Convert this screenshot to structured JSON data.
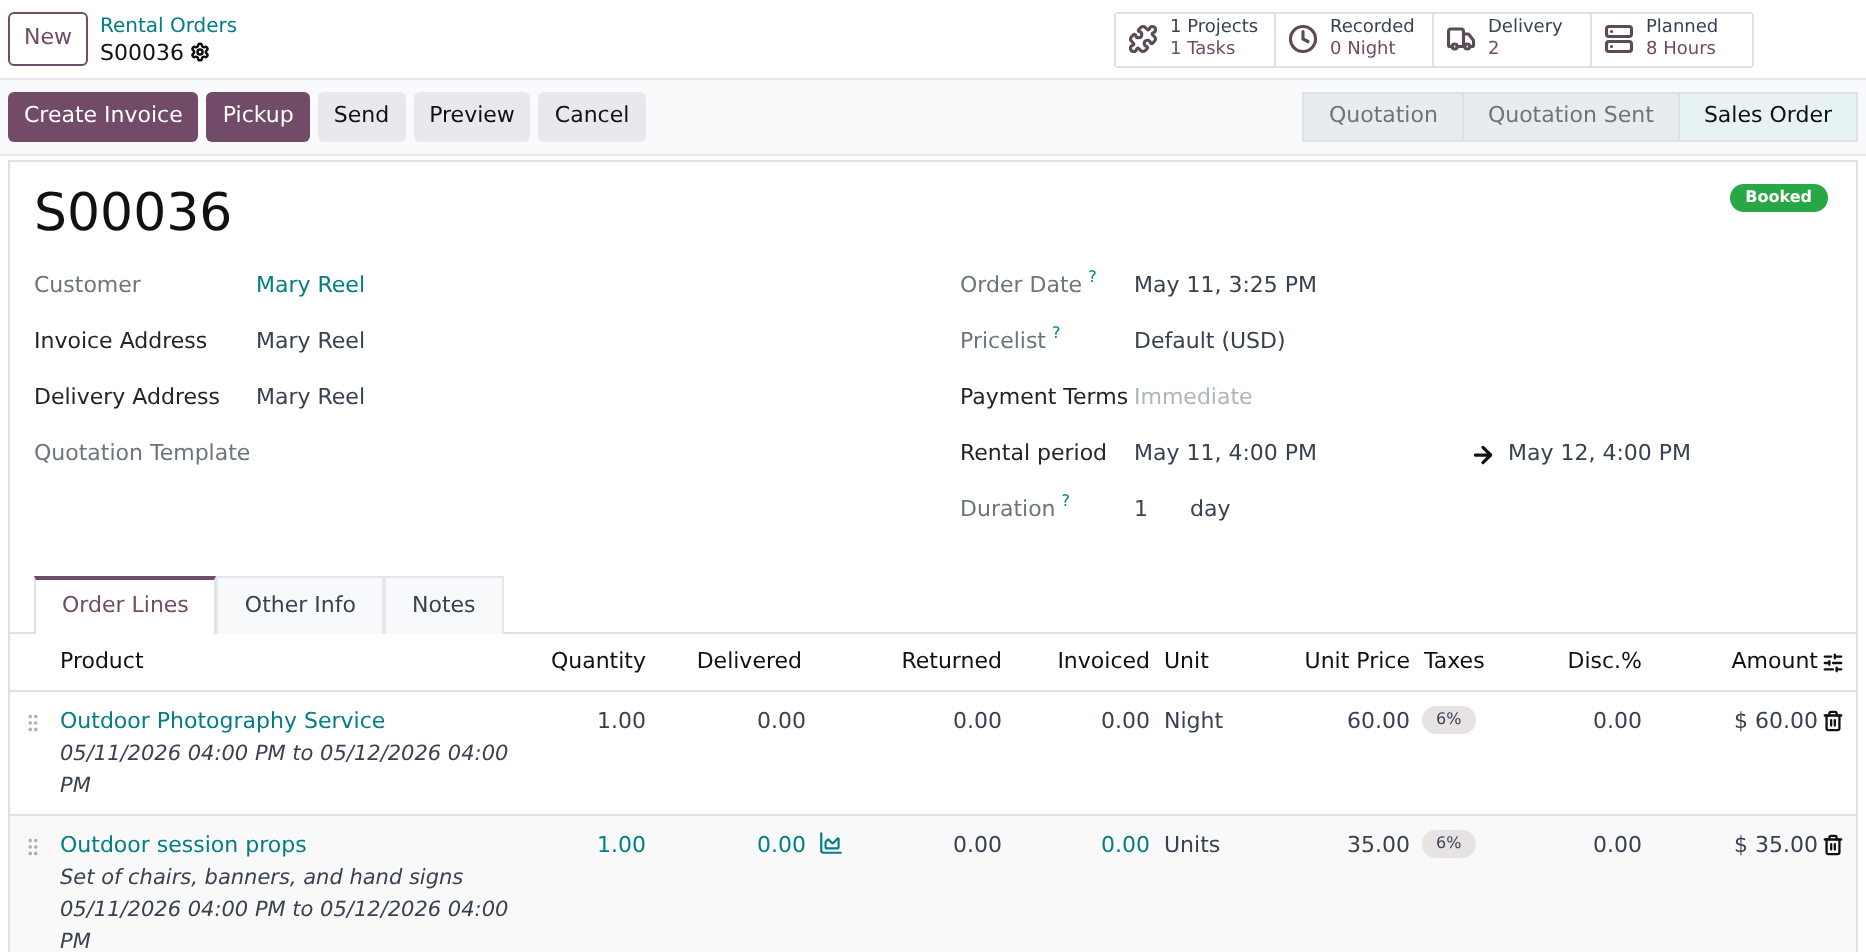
{
  "breadcrumb": {
    "new_button": "New",
    "parent": "Rental Orders",
    "current": "S00036"
  },
  "smart_buttons": [
    {
      "line1": "1 Projects",
      "line2": "1 Tasks"
    },
    {
      "line1": "Recorded",
      "line2": "0 Night"
    },
    {
      "line1": "Delivery",
      "line2": "2"
    },
    {
      "line1": "Planned",
      "line2": "8 Hours"
    }
  ],
  "actions": [
    {
      "label": "Create Invoice",
      "primary": true
    },
    {
      "label": "Pickup",
      "primary": true
    },
    {
      "label": "Send",
      "primary": false
    },
    {
      "label": "Preview",
      "primary": false
    },
    {
      "label": "Cancel",
      "primary": false
    }
  ],
  "stages": [
    {
      "label": "Quotation",
      "selected": false
    },
    {
      "label": "Quotation Sent",
      "selected": false
    },
    {
      "label": "Sales Order",
      "selected": true
    }
  ],
  "record": {
    "name": "S00036",
    "ribbon": "Booked"
  },
  "left_fields": [
    {
      "label": "Customer",
      "required": false,
      "value": "Mary Reel",
      "kind": "link"
    },
    {
      "label": "Invoice Address",
      "required": true,
      "value": "Mary Reel",
      "kind": "text"
    },
    {
      "label": "Delivery Address",
      "required": true,
      "value": "Mary Reel",
      "kind": "text"
    },
    {
      "label": "Quotation Template",
      "required": false,
      "kind": "empty"
    }
  ],
  "right_fields": [
    {
      "label": "Order Date",
      "help": "?",
      "required": false,
      "value": "May 11, 3:25 PM",
      "kind": "text"
    },
    {
      "label": "Pricelist",
      "help": "?",
      "required": false,
      "value": "Default (USD)",
      "kind": "text"
    },
    {
      "label": "Payment Terms",
      "required": true,
      "placeholder": "Immediate",
      "kind": "placeholder"
    },
    {
      "label": "Rental period",
      "required": true,
      "value": "May 11, 4:00 PM",
      "end": "May 12, 4:00 PM",
      "kind": "range"
    },
    {
      "label": "Duration",
      "help": "?",
      "required": false,
      "value": "1",
      "unit": "day",
      "kind": "duration"
    }
  ],
  "tabs": [
    {
      "label": "Order Lines",
      "selected": true
    },
    {
      "label": "Other Info",
      "selected": false
    },
    {
      "label": "Notes",
      "selected": false
    }
  ],
  "table": {
    "columns": [
      "Product",
      "Quantity",
      "Delivered",
      "Returned",
      "Invoiced",
      "Unit",
      "Unit Price",
      "Taxes",
      "Disc.%",
      "Amount"
    ],
    "rows": [
      {
        "product": "Outdoor Photography Service",
        "description": [
          "05/11/2026 04:00 PM to 05/12/2026 04:00 PM"
        ],
        "quantity": {
          "text": "1.00",
          "linked": false
        },
        "delivered": {
          "text": "0.00",
          "linked": false
        },
        "forecast": false,
        "returned": "0.00",
        "invoiced": {
          "text": "0.00",
          "linked": false
        },
        "unit": "Night",
        "unit_price": "60.00",
        "taxes": "6%",
        "discount": "0.00",
        "amount": "$ 60.00"
      },
      {
        "product": "Outdoor session props",
        "description": [
          "Set of chairs, banners, and hand signs",
          "05/11/2026 04:00 PM to 05/12/2026 04:00 PM"
        ],
        "quantity": {
          "text": "1.00",
          "linked": true
        },
        "delivered": {
          "text": "0.00",
          "linked": true
        },
        "forecast": true,
        "returned": "0.00",
        "invoiced": {
          "text": "0.00",
          "linked": true
        },
        "unit": "Units",
        "unit_price": "35.00",
        "taxes": "6%",
        "discount": "0.00",
        "amount": "$ 35.00"
      }
    ]
  }
}
